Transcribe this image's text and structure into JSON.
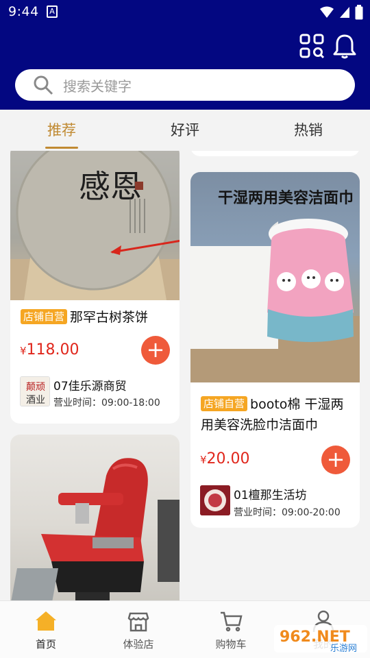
{
  "status_bar": {
    "time": "9:44",
    "notif": "A"
  },
  "search": {
    "placeholder": "搜索关键字"
  },
  "tabs": [
    {
      "label": "推荐",
      "active": true
    },
    {
      "label": "好评",
      "active": false
    },
    {
      "label": "热销",
      "active": false
    }
  ],
  "products": [
    {
      "badge": "店铺自营",
      "title": "那罕古树茶饼",
      "price_symbol": "¥",
      "price": "118.00",
      "shop_name": "07佳乐源商贸",
      "hours": "营业时间：09:00-18:00",
      "image_text": "感恩"
    },
    {
      "badge": "店铺自营",
      "title": "booto棉 干湿两用美容洗脸巾洁面巾",
      "price_symbol": "¥",
      "price": "20.00",
      "shop_name": "01檀那生活坊",
      "hours": "营业时间：09:00-20:00",
      "image_text": "干湿两用美容洁面巾"
    }
  ],
  "shop_logo_text": [
    "颠顽",
    "酒业"
  ],
  "bottom_nav": [
    {
      "label": "首页",
      "icon": "home-icon",
      "active": true
    },
    {
      "label": "体验店",
      "icon": "store-icon",
      "active": false
    },
    {
      "label": "购物车",
      "icon": "cart-icon",
      "active": false
    },
    {
      "label": "我的",
      "icon": "user-icon",
      "active": false
    }
  ],
  "watermark": {
    "text": "962.NET",
    "sub": "乐游网"
  },
  "colors": {
    "header": "#030781",
    "accent": "#c08a32",
    "price": "#e0261b",
    "badge": "#f5a623",
    "add_button": "#ef5a3a"
  }
}
